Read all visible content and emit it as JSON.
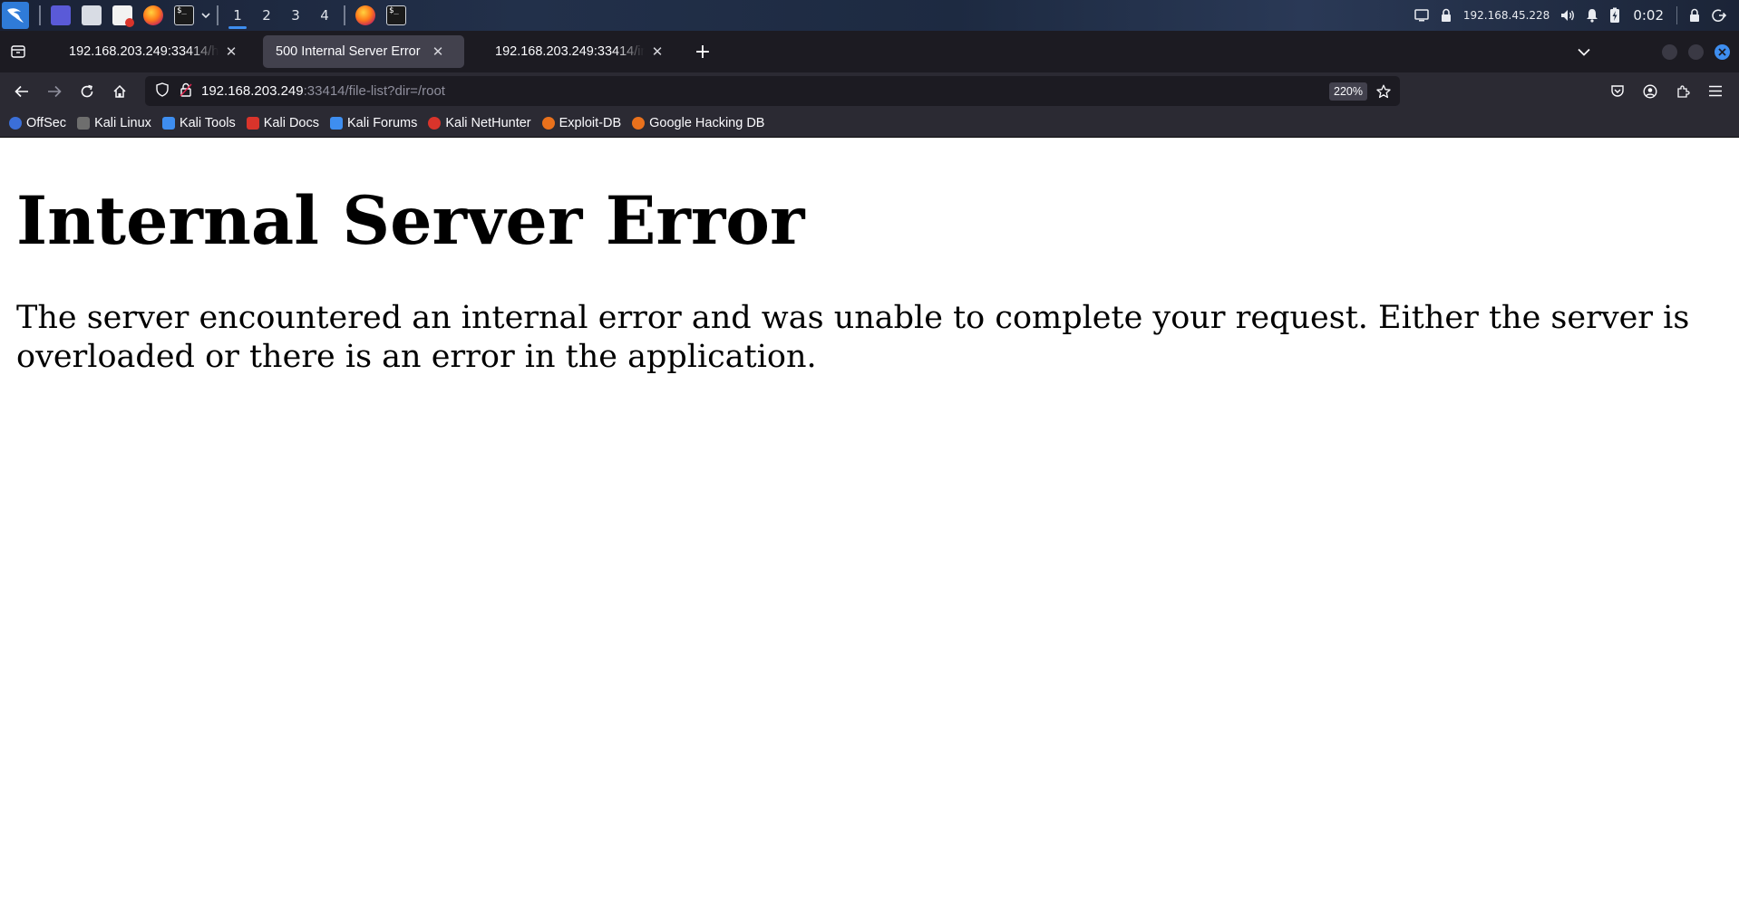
{
  "panel": {
    "workspaces": [
      "1",
      "2",
      "3",
      "4"
    ],
    "active_workspace": "1",
    "ip": "192.168.45.228",
    "clock": "0:02",
    "icons": [
      "kali-menu-icon",
      "desktop-icon",
      "file-manager-icon",
      "text-editor-icon",
      "firefox-icon",
      "terminal-icon"
    ]
  },
  "tabs": [
    {
      "title": "192.168.203.249:33414/h",
      "active": false
    },
    {
      "title": "500 Internal Server Error",
      "active": true
    },
    {
      "title": "192.168.203.249:33414/in",
      "active": false
    }
  ],
  "nav": {
    "url_host": "192.168.203.249",
    "url_path": ":33414/file-list?dir=/root",
    "zoom": "220%"
  },
  "bookmarks": [
    {
      "label": "OffSec",
      "color": "#3b6fd8"
    },
    {
      "label": "Kali Linux",
      "color": "#8a8a8a"
    },
    {
      "label": "Kali Tools",
      "color": "#3e8ef0"
    },
    {
      "label": "Kali Docs",
      "color": "#d9342b"
    },
    {
      "label": "Kali Forums",
      "color": "#3e8ef0"
    },
    {
      "label": "Kali NetHunter",
      "color": "#d9342b"
    },
    {
      "label": "Exploit-DB",
      "color": "#e9711c"
    },
    {
      "label": "Google Hacking DB",
      "color": "#e9711c"
    }
  ],
  "page": {
    "title": "Internal Server Error",
    "message": "The server encountered an internal error and was unable to complete your request. Either the server is overloaded or there is an error in the application."
  },
  "colors": {
    "accent": "#3e8ef0",
    "toolbar": "#2b2a33",
    "tabstrip": "#1c1b22"
  }
}
